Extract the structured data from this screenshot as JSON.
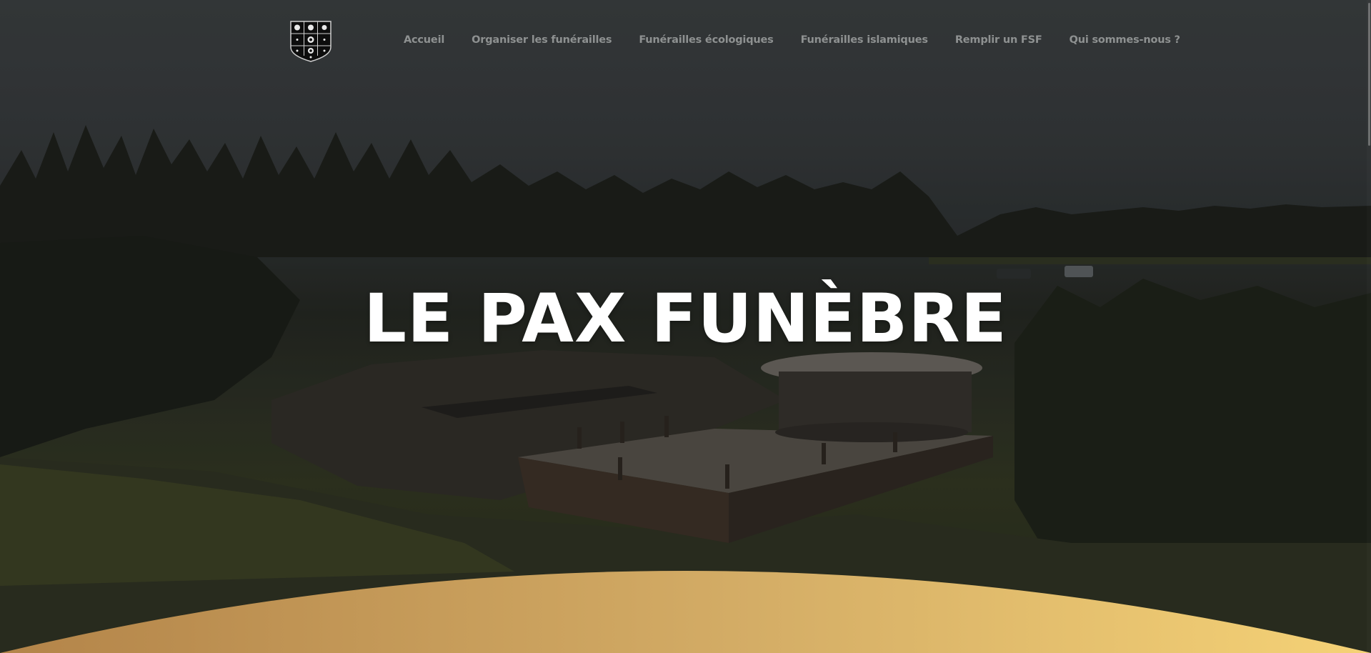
{
  "nav": {
    "items": [
      {
        "label": "Accueil"
      },
      {
        "label": "Organiser les funérailles"
      },
      {
        "label": "Funérailles écologiques"
      },
      {
        "label": "Funérailles islamiques"
      },
      {
        "label": "Remplir un FSF"
      },
      {
        "label": "Qui sommes-nous ?"
      }
    ]
  },
  "hero": {
    "title": "LE PAX FUNÈBRE"
  },
  "colors": {
    "nav_text": "#8e9191",
    "hero_title": "#ffffff",
    "gold_start": "#b38449",
    "gold_end": "#f5d276"
  }
}
